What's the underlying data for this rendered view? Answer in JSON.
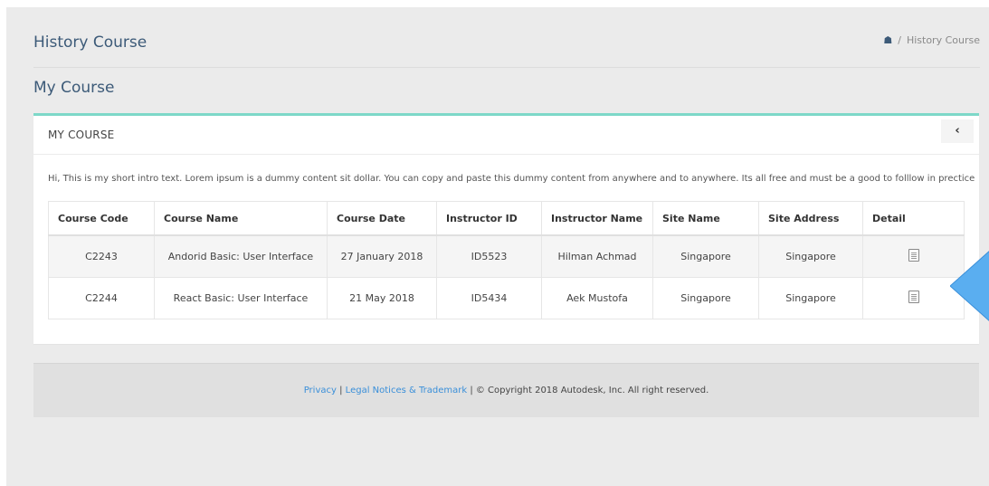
{
  "header": {
    "title": "History Course",
    "breadcrumb": {
      "separator": "/",
      "current": "History Course"
    }
  },
  "section": {
    "title": "My Course"
  },
  "card": {
    "title": "MY COURSE",
    "collapse_label": "‹",
    "intro": "Hi, This is my short intro text. Lorem ipsum is a dummy content sit dollar. You can copy and paste this dummy content from anywhere and to anywhere. Its all free and must be a good to folllow in prectice"
  },
  "table": {
    "columns": [
      "Course Code",
      "Course Name",
      "Course Date",
      "Instructor ID",
      "Instructor Name",
      "Site Name",
      "Site Address",
      "Detail"
    ],
    "rows": [
      [
        "C2243",
        "Andorid Basic: User Interface",
        "27 January 2018",
        "ID5523",
        "Hilman Achmad",
        "Singapore",
        "Singapore"
      ],
      [
        "C2244",
        "React Basic: User Interface",
        "21 May 2018",
        "ID5434",
        "Aek Mustofa",
        "Singapore",
        "Singapore"
      ]
    ]
  },
  "footer": {
    "privacy": "Privacy",
    "divider": "|",
    "legal": "Legal Notices & Trademark",
    "copyright": "| © Copyright 2018 Autodesk, Inc. All right reserved."
  },
  "colors": {
    "accent_teal": "#7dd8c8",
    "title_blue": "#3c5a78",
    "link_blue": "#3a8fd9",
    "diamond_blue": "#5aaef0"
  },
  "icons": {
    "home": "home-icon",
    "detail": "document-icon",
    "collapse": "chevron-left-icon"
  }
}
